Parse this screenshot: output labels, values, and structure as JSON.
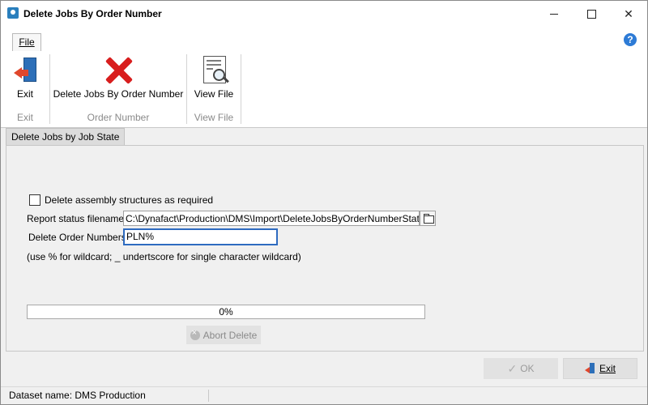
{
  "window": {
    "title": "Delete Jobs By Order Number"
  },
  "ribbon": {
    "file_tab": "File",
    "groups": [
      {
        "button": "Exit",
        "caption": "Exit",
        "icon": "exit-door-icon"
      },
      {
        "button": "Delete Jobs By Order Number",
        "caption": "Order Number",
        "icon": "red-x-icon"
      },
      {
        "button": "View File",
        "caption": "View File",
        "icon": "view-file-icon"
      }
    ]
  },
  "tab": {
    "label": "Delete Jobs by Job State"
  },
  "form": {
    "checkbox_label": "Delete assembly structures as required",
    "checkbox_checked": false,
    "status_file_label": "Report status filename:",
    "status_file_value": "C:\\Dynafact\\Production\\DMS\\Import\\DeleteJobsByOrderNumberStatus.TXT",
    "order_numbers_label": "Delete Order Numbers",
    "order_numbers_value": "PLN%",
    "hint": "(use % for wildcard; _ undertscore for single character wildcard)"
  },
  "progress": {
    "value": 0,
    "label": "0%"
  },
  "buttons": {
    "abort": "Abort Delete",
    "ok": "OK",
    "exit": "Exit"
  },
  "status": {
    "dataset": "Dataset name:  DMS Production"
  },
  "colors": {
    "accent": "#2e6bc0",
    "progress": "#06b025",
    "delete": "#d81e1e"
  }
}
